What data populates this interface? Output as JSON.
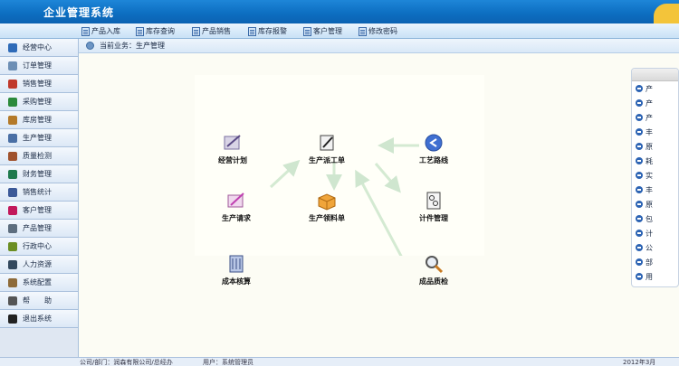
{
  "header": {
    "title": "企业管理系统"
  },
  "toolbar": {
    "items": [
      {
        "label": "产品入库"
      },
      {
        "label": "库存查询"
      },
      {
        "label": "产品销售"
      },
      {
        "label": "库存报警"
      },
      {
        "label": "客户管理"
      },
      {
        "label": "修改密码"
      }
    ]
  },
  "sidebar": {
    "items": [
      {
        "label": "经营中心",
        "icon": "globe-icon",
        "color": "#2f6bb8"
      },
      {
        "label": "订单管理",
        "icon": "order-icon",
        "color": "#6d8fb5"
      },
      {
        "label": "销售管理",
        "icon": "sales-chart-icon",
        "color": "#c0392b"
      },
      {
        "label": "采购管理",
        "icon": "purchase-icon",
        "color": "#2c8a3b"
      },
      {
        "label": "库房管理",
        "icon": "warehouse-icon",
        "color": "#b47a2a"
      },
      {
        "label": "生产管理",
        "icon": "production-icon",
        "color": "#4a6fa5"
      },
      {
        "label": "质量检测",
        "icon": "quality-icon",
        "color": "#a0522d"
      },
      {
        "label": "财务管理",
        "icon": "finance-icon",
        "color": "#1f7a4d"
      },
      {
        "label": "销售统计",
        "icon": "stats-icon",
        "color": "#3b5998"
      },
      {
        "label": "客户管理",
        "icon": "customer-icon",
        "color": "#c2185b"
      },
      {
        "label": "产品管理",
        "icon": "product-icon",
        "color": "#5d6d7e"
      },
      {
        "label": "行政中心",
        "icon": "admin-icon",
        "color": "#6b8e23"
      },
      {
        "label": "人力资源",
        "icon": "hr-icon",
        "color": "#34495e"
      },
      {
        "label": "系统配置",
        "icon": "config-icon",
        "color": "#8e6b3a"
      },
      {
        "label": "帮　　助",
        "icon": "help-icon",
        "color": "#555555"
      },
      {
        "label": "退出系统",
        "icon": "exit-icon",
        "color": "#222222"
      }
    ]
  },
  "breadcrumb": {
    "text": "当前业务：生产管理"
  },
  "diagram": {
    "nodes": [
      {
        "label": "经营计划",
        "icon": "plan-icon"
      },
      {
        "label": "生产派工单",
        "icon": "dispatch-icon"
      },
      {
        "label": "工艺路线",
        "icon": "route-icon"
      },
      {
        "label": "生产请求",
        "icon": "request-icon"
      },
      {
        "label": "生产领料单",
        "icon": "material-icon"
      },
      {
        "label": "计件管理",
        "icon": "piecework-icon"
      },
      {
        "label": "成本核算",
        "icon": "cost-icon"
      },
      {
        "label": "成品质检",
        "icon": "inspection-icon"
      }
    ]
  },
  "right_panel": {
    "items": [
      "产",
      "产",
      "产",
      "丰",
      "原",
      "耗",
      "实",
      "丰",
      "原",
      "包",
      "计",
      "公",
      "部",
      "用"
    ]
  },
  "status": {
    "org": "公司/部门：润森有限公司/总经办",
    "user": "用户：系统管理员",
    "date": "2012年3月"
  }
}
